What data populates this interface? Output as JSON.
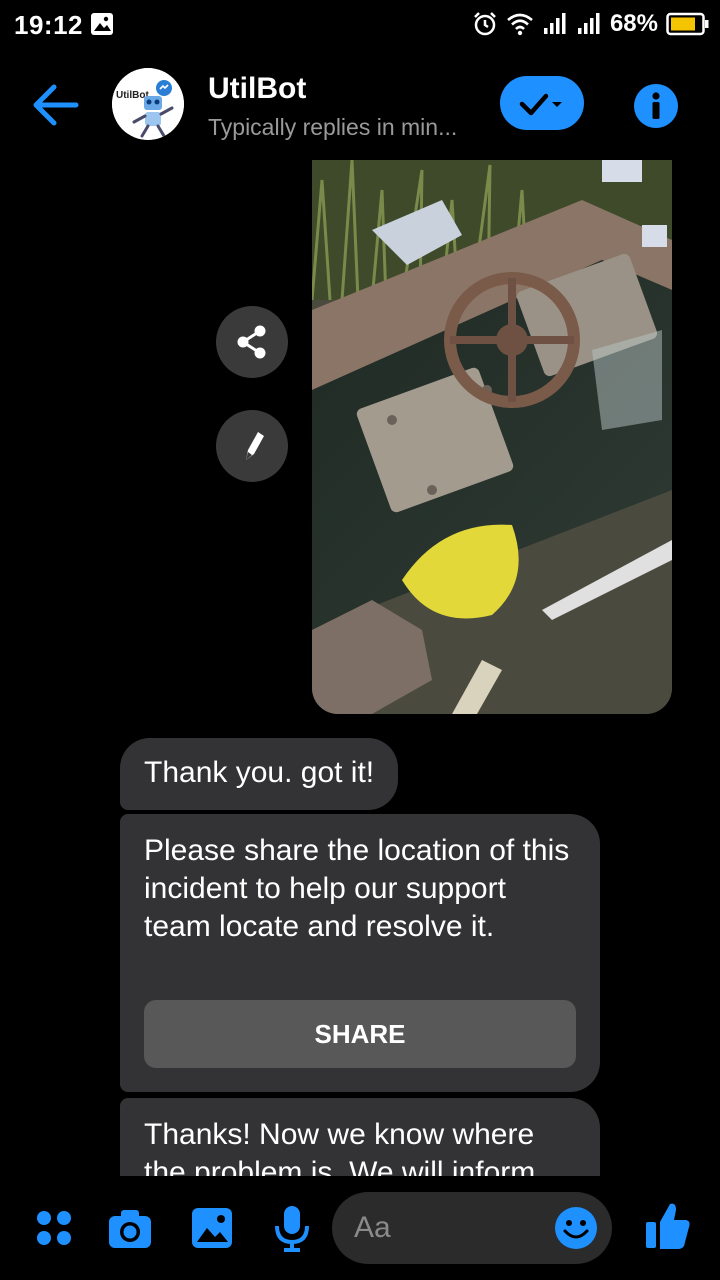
{
  "status_bar": {
    "time": "19:12",
    "battery_percent": "68%",
    "icons": [
      "gallery-icon",
      "alarm-icon",
      "wifi-icon",
      "signal-icon",
      "signal-icon",
      "battery-icon"
    ]
  },
  "header": {
    "name": "UtilBot",
    "status": "Typically replies in min...",
    "avatar_text": "UtilBot",
    "accent": "#1e90ff"
  },
  "chat": {
    "photo_icon": "valve-photo",
    "messages": [
      {
        "text": "Thank you. got it!"
      },
      {
        "text": "Please share the location of this incident to help our support team locate and resolve it.",
        "button": "SHARE"
      },
      {
        "text": "Thanks! Now we know where the problem is. We will inform"
      }
    ]
  },
  "composer": {
    "placeholder": "Aa"
  }
}
